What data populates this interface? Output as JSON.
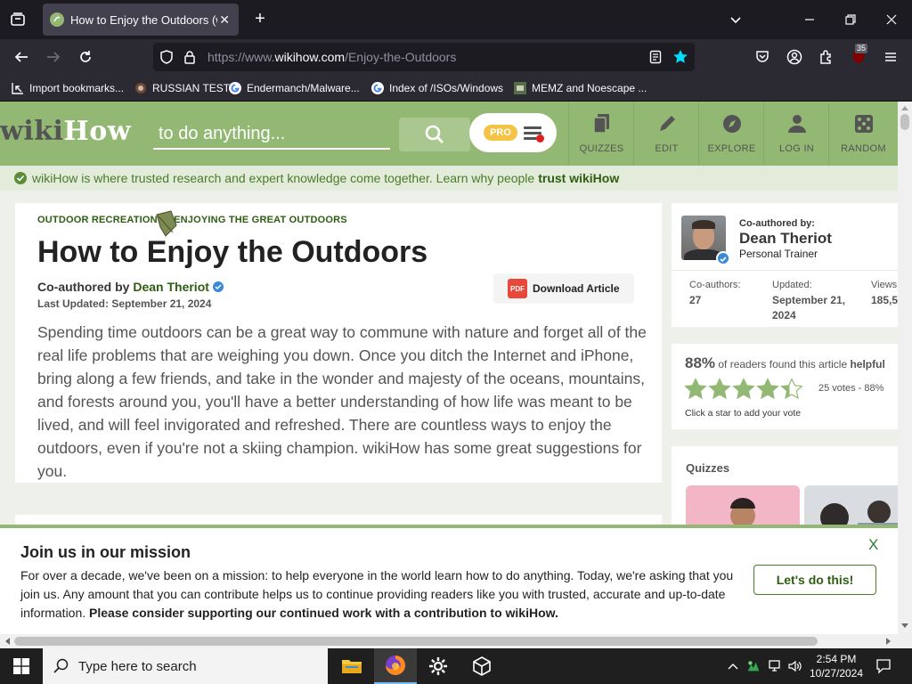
{
  "browser": {
    "tab": {
      "title": "How to Enjoy the Outdoors (with Pictures) - wikiHow",
      "close": "✕"
    },
    "new_tab": "+",
    "url": {
      "scheme_host": "https://www.",
      "domain": "wikihow.com",
      "path": "/Enjoy-the-Outdoors"
    },
    "extension_badge": "35",
    "bookmarks": [
      {
        "label": "Import bookmarks...",
        "icon": "import-icon"
      },
      {
        "label": "RUSSIAN TEST",
        "icon": "russian-test-favicon"
      },
      {
        "label": "Endermanch/Malware...",
        "icon": "google-favicon"
      },
      {
        "label": "Index of /ISOs/Windows",
        "icon": "google-favicon"
      },
      {
        "label": "MEMZ and Noescape ...",
        "icon": "image-favicon"
      }
    ]
  },
  "wikihow": {
    "logo": {
      "part1": "wiki",
      "part2": "How"
    },
    "search_placeholder": "to do anything...",
    "pro_label": "PRO",
    "nav": [
      {
        "label": "QUIZZES",
        "icon": "quizzes-icon"
      },
      {
        "label": "EDIT",
        "icon": "pencil-icon"
      },
      {
        "label": "EXPLORE",
        "icon": "compass-icon"
      },
      {
        "label": "LOG IN",
        "icon": "user-icon"
      },
      {
        "label": "RANDOM",
        "icon": "dice-icon"
      }
    ],
    "trust_bar": {
      "text": "wikiHow is where trusted research and expert knowledge come together. Learn why people",
      "link": "trust wikiHow"
    },
    "article": {
      "breadcrumbs": [
        "OUTDOOR RECREATION",
        "»",
        "ENJOYING THE GREAT OUTDOORS"
      ],
      "title": "How to Enjoy the Outdoors",
      "coauthored_prefix": "Co-authored by",
      "author": "Dean Theriot",
      "last_updated": "Last Updated: September 21, 2024",
      "download_label": "Download Article",
      "pdf_label": "PDF",
      "intro": "Spending time outdoors can be a great way to commune with nature and forget all of the real life problems that are weighing you down. Once you ditch the Internet and iPhone, bring along a few friends, and take in the wonder and majesty of the oceans, mountains, and forests around you, you'll have a better understanding of how life was meant to be lived, and will feel invigorated and refreshed. There are countless ways to enjoy the outdoors, even if you're not a skiing champion. wikiHow has some great suggestions for you."
    },
    "sidebar": {
      "coauthor_label": "Co-authored by:",
      "coauthor_name": "Dean Theriot",
      "coauthor_role": "Personal Trainer",
      "stats": [
        {
          "label": "Co-authors:",
          "value": "27"
        },
        {
          "label": "Updated:",
          "value": "September 21, 2024"
        },
        {
          "label": "Views:",
          "value": "185,5"
        }
      ],
      "rating": {
        "percent": "88%",
        "text": "of readers found this article",
        "tail": "helpful",
        "stars_filled": 4.4,
        "votes": "25 votes - 88%",
        "hint": "Click a star to add your vote"
      },
      "quizzes_title": "Quizzes"
    },
    "mission": {
      "title": "Join us in our mission",
      "body": "For over a decade, we've been on a mission: to help everyone in the world learn how to do anything. Today, we're asking that you join us. Any amount that you can contribute helps us to continue providing readers like you with trusted, accurate and up-to-date information.",
      "bold": "Please consider supporting our continued work with a contribution to wikiHow.",
      "close": "X",
      "cta": "Let's do this!"
    }
  },
  "taskbar": {
    "search_placeholder": "Type here to search",
    "time": "2:54 PM",
    "date": "10/27/2024"
  },
  "colors": {
    "wikihow_green": "#93b874",
    "link_green": "#2e5d12",
    "star_green": "#93b874"
  }
}
